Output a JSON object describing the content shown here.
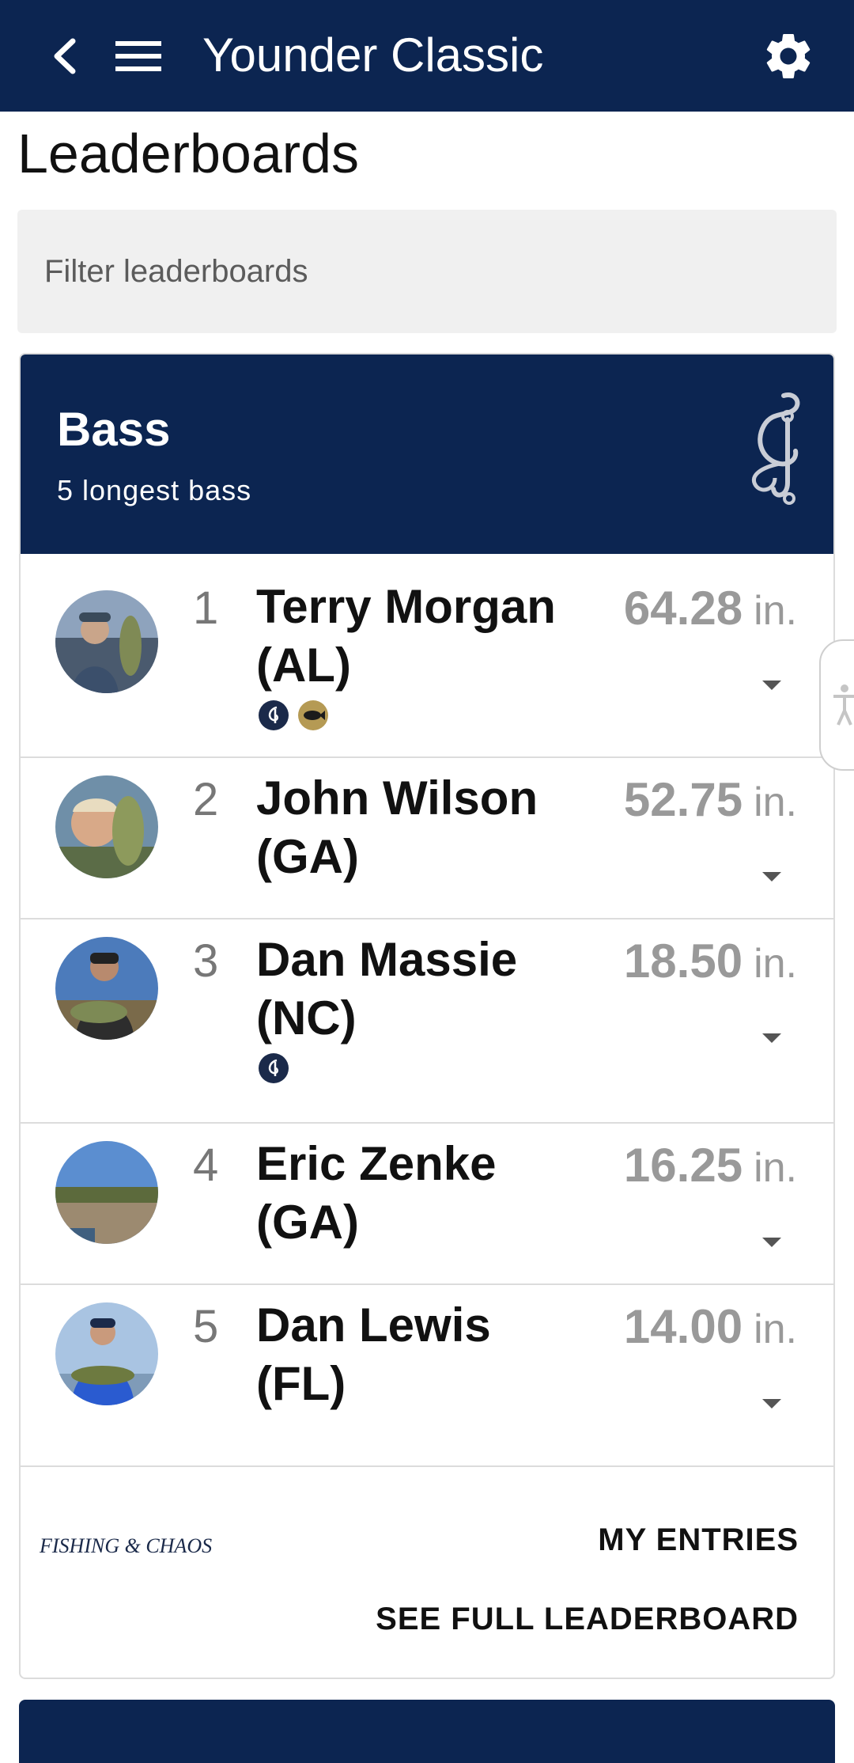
{
  "appbar": {
    "title": "Younder Classic",
    "icons": [
      "back-icon",
      "menu-icon",
      "gear-icon"
    ]
  },
  "page_title": "Leaderboards",
  "filter": {
    "placeholder": "Filter leaderboards",
    "value": ""
  },
  "leaderboard": {
    "title": "Bass",
    "subtitle": "5 longest bass",
    "entries": [
      {
        "rank": "1",
        "name": "Terry Morgan (AL)",
        "value": "64.28",
        "unit": "in.",
        "badges": [
          "fc-badge",
          "fish-badge"
        ]
      },
      {
        "rank": "2",
        "name": "John Wilson (GA)",
        "value": "52.75",
        "unit": "in.",
        "badges": []
      },
      {
        "rank": "3",
        "name": "Dan Massie (NC)",
        "value": "18.50",
        "unit": "in.",
        "badges": [
          "fc-badge"
        ]
      },
      {
        "rank": "4",
        "name": "Eric Zenke (GA)",
        "value": "16.25",
        "unit": "in.",
        "badges": []
      },
      {
        "rank": "5",
        "name": "Dan Lewis (FL)",
        "value": "14.00",
        "unit": "in.",
        "badges": []
      }
    ],
    "footer_logo_text": "FISHING & CHAOS",
    "my_entries_label": "MY ENTRIES",
    "see_full_label": "SEE FULL LEADERBOARD"
  },
  "colors": {
    "primary": "#0c2551",
    "value_gray": "#999999",
    "badge_gold": "#b59a54"
  }
}
